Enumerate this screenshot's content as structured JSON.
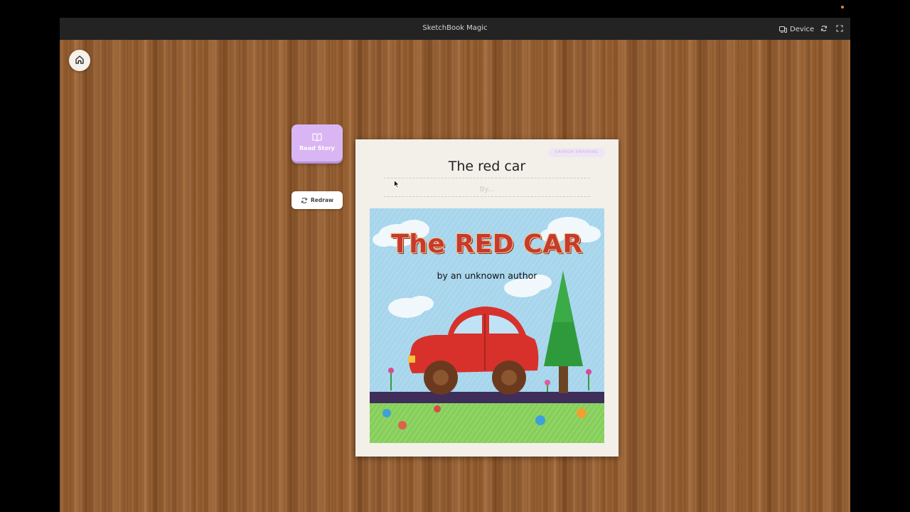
{
  "app": {
    "title": "SketchBook Magic",
    "device_label": "Device"
  },
  "icons": {
    "device": "device-icon",
    "refresh": "refresh-icon",
    "fullscreen": "fullscreen-icon",
    "home": "home-icon",
    "book": "book-icon",
    "redraw": "redraw-icon"
  },
  "sidebar": {
    "read_story_label": "Read Story",
    "redraw_label": "Redraw"
  },
  "book": {
    "style_badge": "CRAYON DRAWING",
    "title": "The red car",
    "author_placeholder": "By...",
    "cover": {
      "title": "The RED CAR",
      "author": "by an unknown author"
    }
  },
  "colors": {
    "accent": "#d9b6f3",
    "wood": "#915a2e",
    "titlebar": "#232323",
    "car": "#d8312c",
    "sky": "#9fd3ea",
    "grass": "#7cc84a"
  }
}
